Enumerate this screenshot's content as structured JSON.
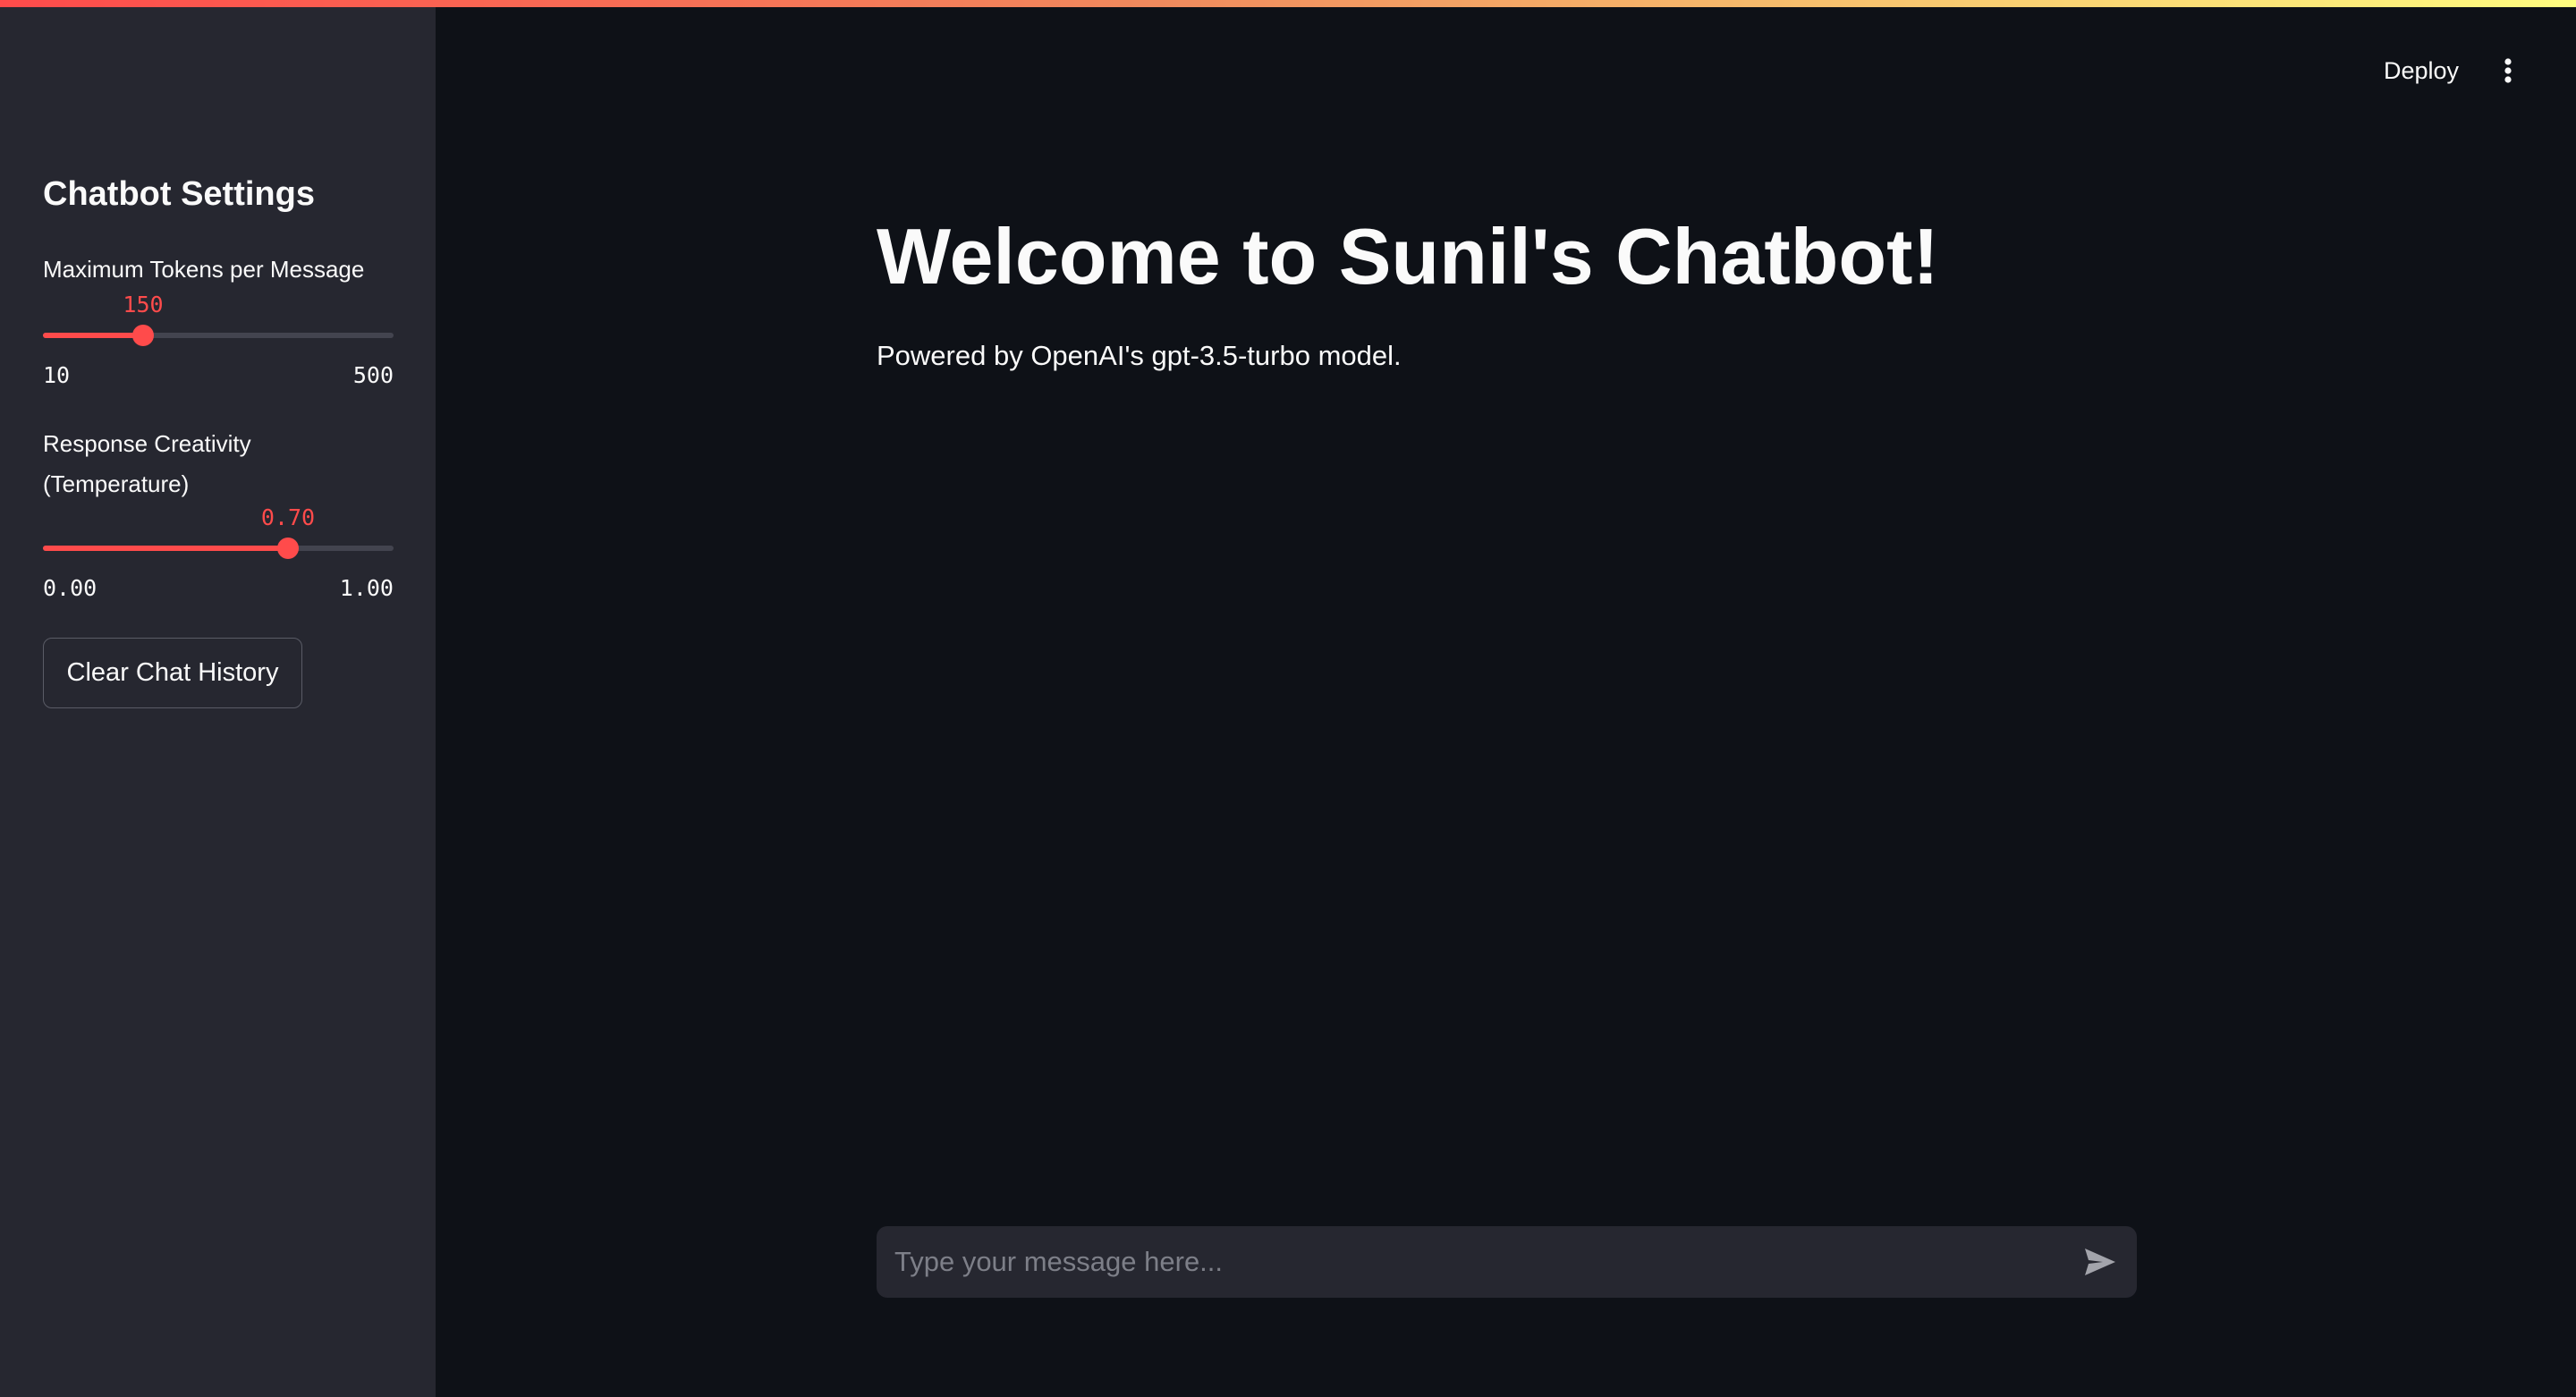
{
  "header": {
    "deploy_label": "Deploy",
    "menu_icon": "vertical-ellipsis-icon"
  },
  "sidebar": {
    "title": "Chatbot Settings",
    "max_tokens": {
      "label": "Maximum Tokens per Message",
      "value": "150",
      "min": "10",
      "max": "500",
      "fraction": 0.2857
    },
    "temperature": {
      "label": "Response Creativity (Temperature)",
      "value": "0.70",
      "min": "0.00",
      "max": "1.00",
      "fraction": 0.7
    },
    "clear_button_label": "Clear Chat History"
  },
  "main": {
    "title": "Welcome to Sunil's Chatbot!",
    "subtitle": "Powered by OpenAI's gpt-3.5-turbo model."
  },
  "chat_input": {
    "placeholder": "Type your message here...",
    "value": "",
    "send_icon": "send-icon"
  },
  "colors": {
    "accent": "#ff4b4b",
    "background": "#0e1117",
    "sidebar_background": "#262730",
    "text": "#fafafa"
  }
}
